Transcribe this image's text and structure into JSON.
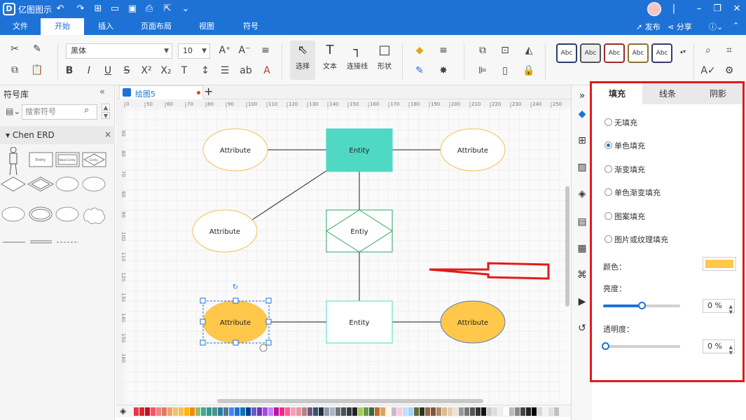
{
  "app": {
    "title": "亿图图示"
  },
  "menu": {
    "tabs": [
      "文件",
      "开始",
      "插入",
      "页面布局",
      "视图",
      "符号"
    ],
    "active_index": 1,
    "publish": "发布",
    "share": "分享"
  },
  "ribbon": {
    "font_name": "黑体",
    "font_size": "10",
    "select_label": "选择",
    "text_label": "文本",
    "connector_label": "连接线",
    "shape_label": "形状",
    "style_presets": [
      "Abc",
      "Abc",
      "Abc",
      "Abc",
      "Abc"
    ],
    "style_colors": [
      "#2d3c6b",
      "#555555",
      "#9b2b2b",
      "#8a7330",
      "#3a3a6a"
    ]
  },
  "library": {
    "title": "符号库",
    "search_placeholder": "搜索符号",
    "lib_name": "Chen ERD",
    "shape_labels": [
      "Entity",
      "Weak Entity",
      "Entity"
    ]
  },
  "document": {
    "tab_name": "绘图5"
  },
  "canvas": {
    "ruler_top": [
      "0",
      "50",
      "60",
      "70",
      "80",
      "90",
      "100",
      "110",
      "120",
      "130",
      "140",
      "150",
      "160",
      "170",
      "180",
      "190",
      "200",
      "210",
      "220",
      "230",
      "240",
      "250"
    ],
    "ruler_left": [
      "90",
      "80",
      "70",
      "60",
      "90",
      "100",
      "110",
      "120",
      "130",
      "140",
      "150",
      "160"
    ],
    "attr1": "Attribute",
    "attr2": "Attribute",
    "attr3": "Attribute",
    "attr4": "Attribute",
    "attr5": "Attribute",
    "entity1": "Entity",
    "relation": "Entiy",
    "entity2": "Entity",
    "colors": {
      "entity_fill": "#4fd8c4",
      "attr_border": "#f2c14e",
      "attr_fill": "#ffc84a",
      "relation_border": "#2aa56a",
      "arrow": "#e31a1a"
    }
  },
  "panel": {
    "tabs": [
      "填充",
      "线条",
      "阴影"
    ],
    "active_tab": 0,
    "options": [
      "无填充",
      "单色填充",
      "渐变填充",
      "单色渐变填充",
      "图案填充",
      "图片或纹理填充"
    ],
    "selected_option": 1,
    "color_label": "颜色：",
    "color_value": "#ffc84a",
    "brightness_label": "亮度：",
    "brightness_value": "0 %",
    "transparency_label": "透明度：",
    "transparency_value": "0 %",
    "highlight_color": "#e31a1a"
  }
}
